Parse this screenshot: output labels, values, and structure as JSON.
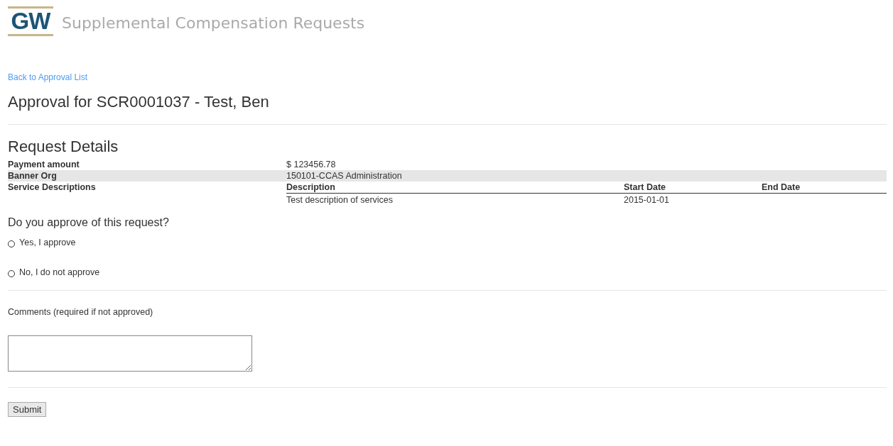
{
  "header": {
    "logo": "GW",
    "title": "Supplemental Compensation Requests"
  },
  "back_link": "Back to Approval List",
  "heading": "Approval for SCR0001037 - Test, Ben",
  "details": {
    "title": "Request Details",
    "rows": [
      {
        "label": "Payment amount",
        "value": "$ 123456.78",
        "selected": false
      },
      {
        "label": "Banner Org",
        "value": "150101-CCAS Administration",
        "selected": true
      }
    ],
    "services": {
      "label": "Service Descriptions",
      "columns": [
        "Description",
        "Start Date",
        "End Date"
      ],
      "rows": [
        [
          "Test description of services",
          "2015-01-01",
          ""
        ]
      ]
    }
  },
  "question": "Do you approve of this request?",
  "options": [
    {
      "label": "Yes, I approve",
      "selected": false
    },
    {
      "label": "No, I do not approve",
      "selected": false
    }
  ],
  "comments": {
    "label": "Comments (required if not approved)"
  },
  "submit": "Submit"
}
